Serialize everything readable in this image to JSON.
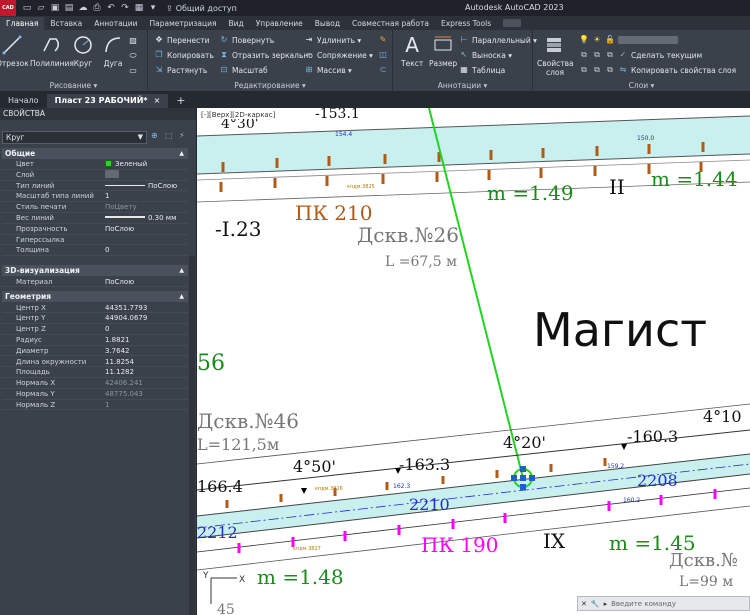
{
  "app": {
    "logo": "CAD",
    "title": "Autodesk AutoCAD 2023",
    "share_label": "Общий доступ"
  },
  "ribbon_tabs": [
    "Главная",
    "Вставка",
    "Аннотации",
    "Параметризация",
    "Вид",
    "Управление",
    "Вывод",
    "Совместная работа",
    "Express Tools"
  ],
  "ribbon": {
    "draw": {
      "label": "Рисование ▾",
      "tools": [
        "Отрезок",
        "Полилиния",
        "Круг",
        "Дуга"
      ]
    },
    "modify": {
      "label": "Редактирование ▾",
      "col1": [
        "Перенести",
        "Копировать",
        "Растянуть"
      ],
      "col2": [
        "Повернуть",
        "Отразить зеркально",
        "Масштаб"
      ],
      "col3": [
        "Удлинить ▾",
        "Сопряжение ▾",
        "Массив ▾"
      ]
    },
    "annotation": {
      "label": "Аннотации ▾",
      "text": "Текст",
      "dimension": "Размер",
      "small": [
        "Параллельный ▾",
        "Выноска ▾",
        "Таблица"
      ]
    },
    "layers": {
      "label": "Слои ▾",
      "props": "Свойства слоя",
      "set_current": "Сделать текущим",
      "copy_props": "Копировать свойства слоя"
    }
  },
  "doc_tabs": {
    "start": "Начало",
    "drawing": "Пласт 23 РАБОЧИЙ*",
    "close": "×",
    "add": "+"
  },
  "properties": {
    "title": "СВОЙСТВА",
    "selected": "Круг",
    "sections": {
      "general": "Общие",
      "viz": "3D-визуализация",
      "geometry": "Геометрия"
    },
    "general": [
      {
        "name": "Цвет",
        "value": "Зеленый"
      },
      {
        "name": "Слой",
        "value": ""
      },
      {
        "name": "Тип линий",
        "value": "ПоСлою"
      },
      {
        "name": "Масштаб типа линий",
        "value": "1"
      },
      {
        "name": "Стиль печати",
        "value": "ПоЦвету"
      },
      {
        "name": "Вес линий",
        "value": "0.30 мм"
      },
      {
        "name": "Прозрачность",
        "value": "ПоСлою"
      },
      {
        "name": "Гиперссылка",
        "value": ""
      },
      {
        "name": "Толщина",
        "value": "0"
      }
    ],
    "viz": [
      {
        "name": "Материал",
        "value": "ПоСлою"
      }
    ],
    "geometry": [
      {
        "name": "Центр X",
        "value": "44351.7793"
      },
      {
        "name": "Центр Y",
        "value": "44904.0679"
      },
      {
        "name": "Центр Z",
        "value": "0"
      },
      {
        "name": "Радиус",
        "value": "1.8821"
      },
      {
        "name": "Диаметр",
        "value": "3.7642"
      },
      {
        "name": "Длина окружности",
        "value": "11.8254"
      },
      {
        "name": "Площадь",
        "value": "11.1282"
      },
      {
        "name": "Нормаль X",
        "value": "42406.241"
      },
      {
        "name": "Нормаль Y",
        "value": "48775.043"
      },
      {
        "name": "Нормаль Z",
        "value": "1"
      }
    ]
  },
  "canvas": {
    "viewport_label": "[-][Верх][2D-каркас]",
    "labels": {
      "angle_top": "4°30'",
      "elev_top": "-153.1",
      "pk210": "ПК 210",
      "m149": "m =1.49",
      "roman2": "II",
      "m144": "m =1.44",
      "i123": "-I.23",
      "dskv26": "Дскв.№26",
      "l675": "L =67,5 м",
      "magist": "Магист",
      "n56": "56",
      "dskv46": "Дскв.№46",
      "l1215": "L=121,5м",
      "angle_mid": "4°20'",
      "elev1603": "-160.3",
      "angle_right": "4°10",
      "angle_left": "4°50'",
      "elev1633": "-163.3",
      "elev1664": "166.4",
      "pipe2210": "2210",
      "pipe2208": "2208",
      "pipe2212": "2212",
      "pk190": "ПК 190",
      "roman9": "IX",
      "m145": "m =1.45",
      "m148": "m =1.48",
      "dskv_br": "Дскв.№",
      "l99": "L=99 м",
      "small_1544": "154.4",
      "small_1500": "150.0",
      "small_1592": "159.2",
      "small_1623": "162.3",
      "small_1602": "160.2",
      "well1": "кпдм.3825",
      "well2": "кпдм.3826",
      "well3": "кпдм.3827",
      "y_axis": "Y",
      "x_axis": "X",
      "bottom_left": "45"
    },
    "cmd_placeholder": "Введите команду"
  },
  "colors": {
    "pipe_fill": "#c8f0ef",
    "pk210": "#b05a14",
    "green_text": "#1a8a1a",
    "magenta": "#ff00ff",
    "blue_dim": "#1f2fd0",
    "selection": "#22d322"
  }
}
